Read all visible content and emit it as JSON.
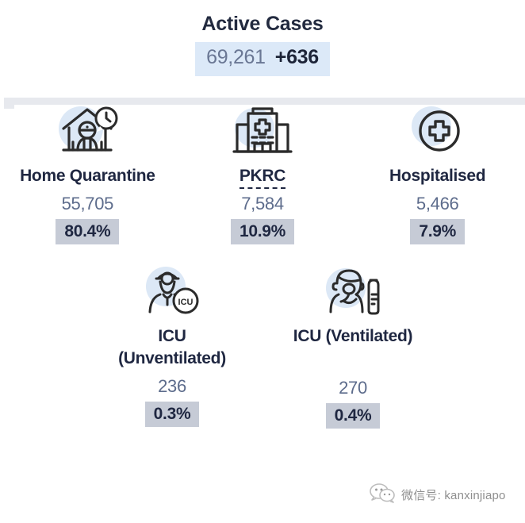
{
  "header": {
    "title": "Active Cases",
    "total_value": "69,261",
    "total_delta": "+636"
  },
  "colors": {
    "title_navy": "#222a3f",
    "total_pill_bg": "#dce9f8",
    "total_value": "#6a7794",
    "total_delta": "#1d2438",
    "label_navy": "#1f2741",
    "value_blue_gray": "#5d6c8c",
    "pct_badge_bg": "#c6cbd6",
    "icon_circle_blue": "#dce8f6",
    "divider_gray": "#e7e9ee",
    "watermark_gray": "#8f8f8f"
  },
  "rows": [
    {
      "cells": [
        {
          "icon": "home-quarantine-icon",
          "label": "Home Quarantine",
          "label_line2": "",
          "dashed_underline": false,
          "value": "55,705",
          "percent": "80.4%"
        },
        {
          "icon": "hospital-building-icon",
          "label": "PKRC",
          "label_line2": "",
          "dashed_underline": true,
          "value": "7,584",
          "percent": "10.9%"
        },
        {
          "icon": "medical-cross-circle-icon",
          "label": "Hospitalised",
          "label_line2": "",
          "dashed_underline": false,
          "value": "5,466",
          "percent": "7.9%"
        }
      ]
    },
    {
      "cells": [
        {
          "icon": "icu-doctor-icon",
          "label": "ICU",
          "label_line2": "(Unventilated)",
          "dashed_underline": false,
          "value": "236",
          "percent": "0.3%"
        },
        {
          "icon": "icu-ventilated-patient-icon",
          "label": "ICU (Ventilated)",
          "label_line2": "",
          "dashed_underline": false,
          "value": "270",
          "percent": "0.4%"
        }
      ]
    }
  ],
  "watermark": {
    "icon": "wechat-icon",
    "text": "微信号: kanxinjiapo"
  }
}
